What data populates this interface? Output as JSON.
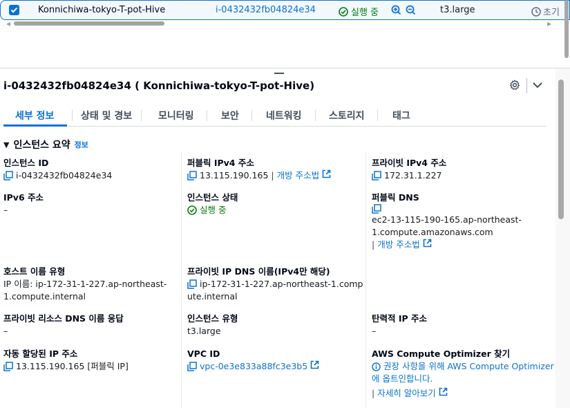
{
  "table_row": {
    "name": "Konnichiwa-tokyo-T-pot-Hive",
    "instance_id": "i-0432432fb04824e34",
    "status": "실행 중",
    "instance_type": "t3.large",
    "status_check": "초기"
  },
  "detail": {
    "title": "i-0432432fb04824e34 ( Konnichiwa-tokyo-T-pot-Hive)",
    "tabs": [
      "세부 정보",
      "상태 및 경보",
      "모니터링",
      "보안",
      "네트워킹",
      "스토리지",
      "태그"
    ],
    "active_tab": "세부 정보",
    "section_title": "인스턴스 요약",
    "section_info": "정보"
  },
  "summary": {
    "instance_id": {
      "label": "인스턴스 ID",
      "value": "i-0432432fb04824e34"
    },
    "public_ipv4": {
      "label": "퍼블릭 IPv4 주소",
      "value": "13.115.190.165",
      "link": "개방 주소법"
    },
    "private_ipv4": {
      "label": "프라이빗 IPv4 주소",
      "value": "172.31.1.227"
    },
    "ipv6": {
      "label": "IPv6 주소",
      "value": "–"
    },
    "instance_state": {
      "label": "인스턴스 상태",
      "value": "실행 중"
    },
    "public_dns": {
      "label": "퍼블릭 DNS",
      "value_line1": "ec2-13-115-190-165.ap-northeast-",
      "value_line2": "1.compute.amazonaws.com",
      "link": "개방 주소법"
    },
    "hostname_type": {
      "label": "호스트 이름 유형",
      "value_line1": "IP 이름: ip-172-31-1-227.ap-northeast-",
      "value_line2": "1.compute.internal"
    },
    "private_dns": {
      "label": "프라이빗 IP DNS 이름(IPv4만 해당)",
      "value_line1": "ip-172-31-1-227.ap-northeast-1.comp",
      "value_line2": "ute.internal"
    },
    "private_dns_answer": {
      "label": "프라이빗 리소스 DNS 이름 응답",
      "value": "–"
    },
    "instance_type": {
      "label": "인스턴스 유형",
      "value": "t3.large"
    },
    "elastic_ip": {
      "label": "탄력적 IP 주소",
      "value": "–"
    },
    "auto_ip": {
      "label": "자동 할당된 IP 주소",
      "value": "13.115.190.165 [퍼블릭 IP]"
    },
    "vpc_id": {
      "label": "VPC ID",
      "value": "vpc-0e3e833a88fc3e3b5"
    },
    "optimizer": {
      "label": "AWS Compute Optimizer 찾기",
      "line1": "권장 사항을 위해 AWS Compute Optimizer",
      "line2": "에 옵트인합니다.",
      "link": "자세히 알아보기"
    }
  },
  "colors": {
    "accent": "#0972d3",
    "success": "#037f0c",
    "text": "#16191f"
  }
}
